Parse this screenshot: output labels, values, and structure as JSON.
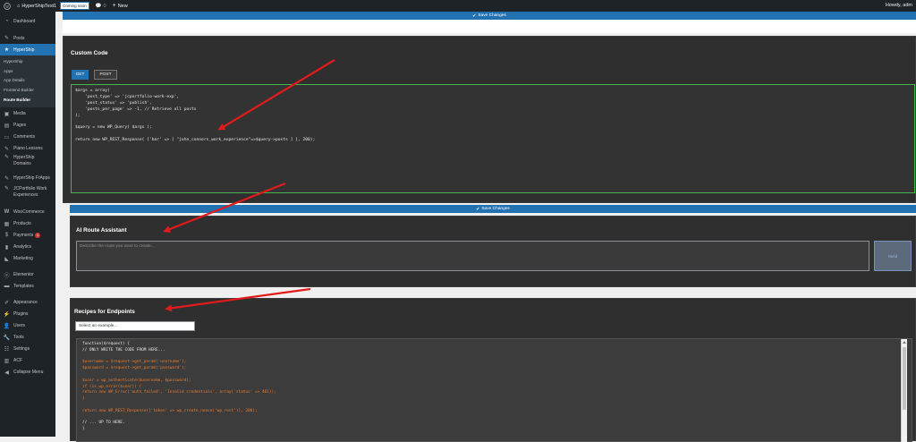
{
  "adminbar": {
    "site_name": "HyperShipTest1",
    "coming_soon": "Coming soon",
    "comments_count": "0",
    "new_label": "New",
    "howdy": "Howdy, adm"
  },
  "sidebar": {
    "items": [
      {
        "label": "Dashboard",
        "icon": "dashboard-icon"
      },
      {
        "label": "Posts",
        "icon": "pin-icon"
      },
      {
        "label": "HyperShip",
        "icon": "star-icon"
      },
      {
        "label": "Media",
        "icon": "media-icon"
      },
      {
        "label": "Pages",
        "icon": "pages-icon"
      },
      {
        "label": "Comments",
        "icon": "comments-icon"
      },
      {
        "label": "Piano Lessons",
        "icon": "pin-icon"
      },
      {
        "label": "HyperShip Domains",
        "icon": "pin-icon"
      },
      {
        "label": "HyperShip FrApps",
        "icon": "pin-icon"
      },
      {
        "label": "JCPortfolio Work Experiences",
        "icon": "pin-icon"
      },
      {
        "label": "WooCommerce",
        "icon": "woo-icon"
      },
      {
        "label": "Products",
        "icon": "products-icon"
      },
      {
        "label": "Payments",
        "icon": "payments-icon",
        "badge": "1"
      },
      {
        "label": "Analytics",
        "icon": "analytics-icon"
      },
      {
        "label": "Marketing",
        "icon": "marketing-icon"
      },
      {
        "label": "Elementor",
        "icon": "elementor-icon"
      },
      {
        "label": "Templates",
        "icon": "templates-icon"
      },
      {
        "label": "Appearance",
        "icon": "appearance-icon"
      },
      {
        "label": "Plugins",
        "icon": "plugins-icon"
      },
      {
        "label": "Users",
        "icon": "users-icon"
      },
      {
        "label": "Tools",
        "icon": "tools-icon"
      },
      {
        "label": "Settings",
        "icon": "settings-icon"
      },
      {
        "label": "ACF",
        "icon": "acf-icon"
      },
      {
        "label": "Collapse Menu",
        "icon": "collapse-icon"
      }
    ],
    "submenu": [
      "HyperShip",
      "Apps",
      "App Details",
      "Frontend Builder",
      "Route Builder"
    ]
  },
  "main": {
    "save_changes": "Save Changes",
    "custom_code": {
      "title": "Custom Code",
      "tab_get": "GET",
      "tab_post": "POST",
      "code": "$args = array(\n    'post_type' => 'jcportfolio-work-exp',\n    'post_status' => 'publish',\n    'posts_per_page' => -1, // Retrieve all posts\n);\n\n$query = new WP_Query( $args );\n\nreturn new WP_REST_Response( ['bar' => [ \"john_connors_work_experience\"=>$query->posts ] ], 200);"
    },
    "ai_assistant": {
      "title": "AI Route Assistant",
      "placeholder": "Describe the route you want to create...",
      "send_label": "Send"
    },
    "recipes": {
      "title": "Recipes for Endpoints",
      "select_value": "Select an example...",
      "code_lines": [
        {
          "t": "function($request) {",
          "c": "w"
        },
        {
          "t": "// ONLY WRITE THE CODE FROM HERE...",
          "c": "w"
        },
        {
          "t": "",
          "c": "w"
        },
        {
          "t": "$username = $request->get_param('username');",
          "c": "o"
        },
        {
          "t": "$password = $request->get_param('password');",
          "c": "o"
        },
        {
          "t": "",
          "c": "w"
        },
        {
          "t": "$user = wp_authenticate($username, $password);",
          "c": "o"
        },
        {
          "t": "if (is_wp_error($user)) {",
          "c": "o"
        },
        {
          "t": "return new WP_Error('auth_failed', 'Invalid credentials', array('status' => 401));",
          "c": "o"
        },
        {
          "t": "}",
          "c": "o"
        },
        {
          "t": "",
          "c": "w"
        },
        {
          "t": "return new WP_REST_Response(['token' => wp_create_nonce('wp_rest')], 200);",
          "c": "o"
        },
        {
          "t": "",
          "c": "w"
        },
        {
          "t": "// ... UP TO HERE.",
          "c": "w"
        },
        {
          "t": "}",
          "c": "w"
        }
      ]
    }
  },
  "colors": {
    "accent": "#2271b1",
    "arrow": "#e11b1b",
    "editor_border": "#46b450",
    "code_orange": "#ef7d2c"
  }
}
